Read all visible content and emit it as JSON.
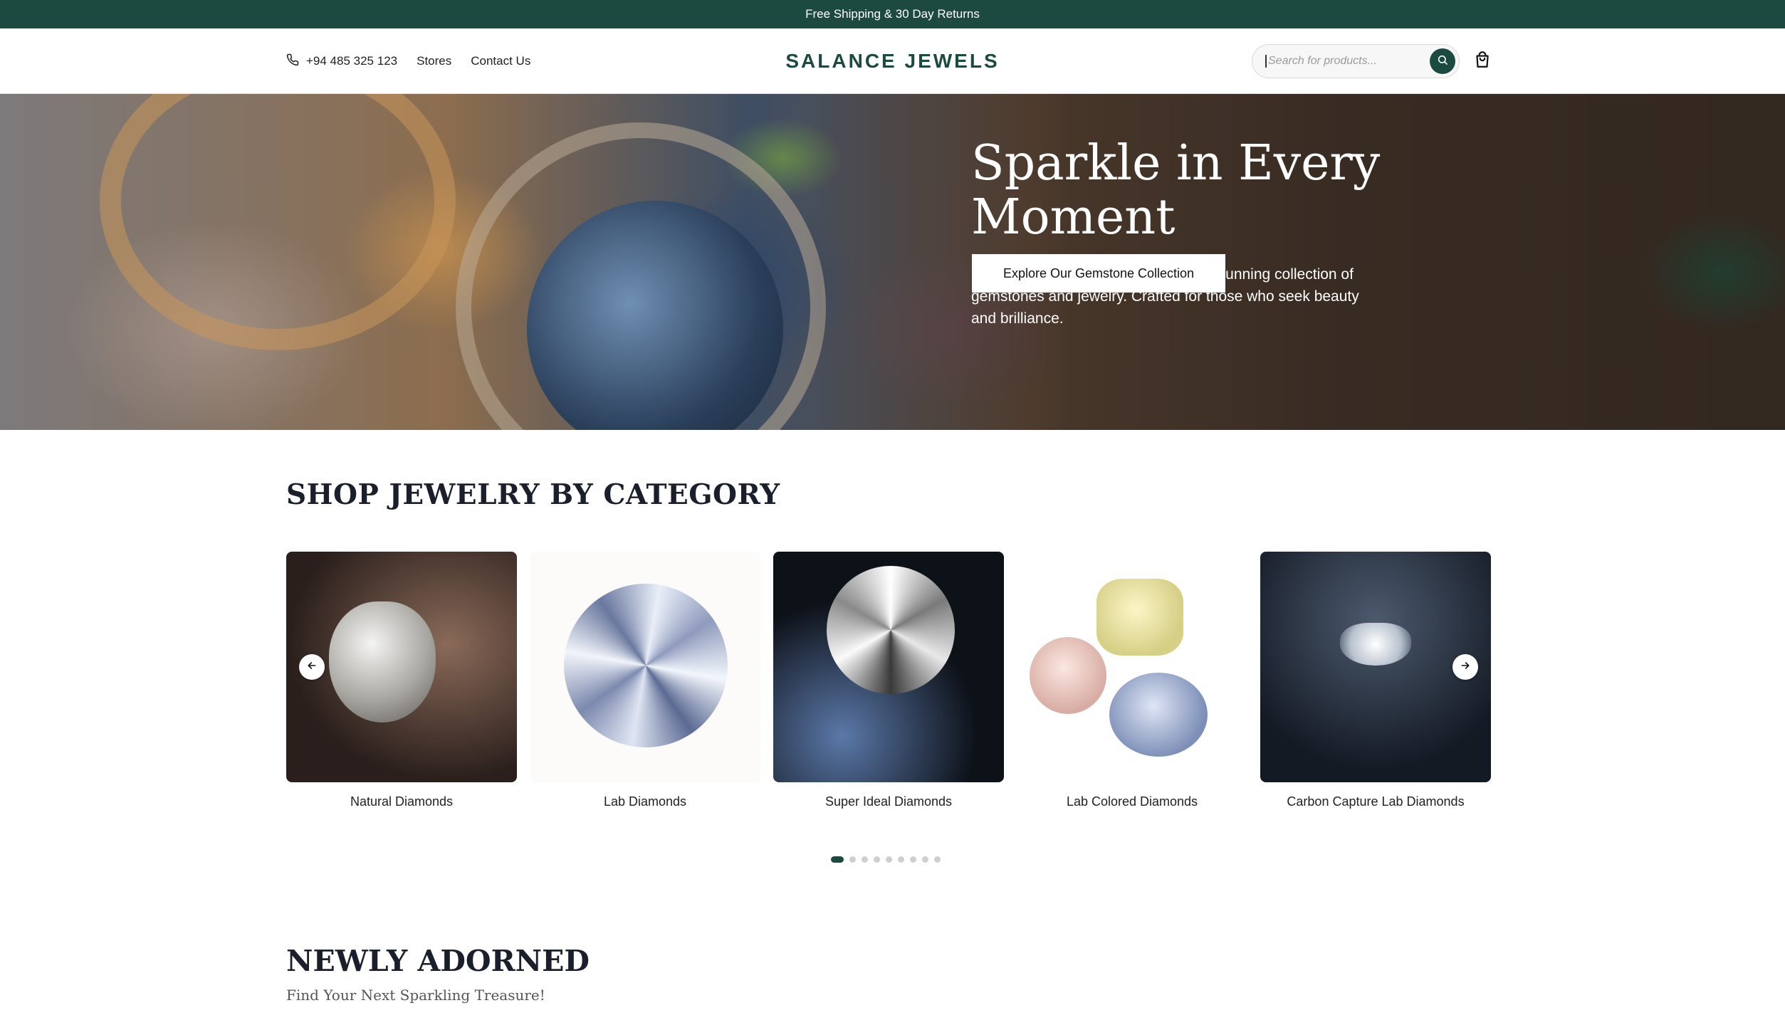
{
  "announcement": "Free Shipping & 30 Day Returns",
  "header": {
    "phone": "+94 485 325 123",
    "nav": [
      "Stores",
      "Contact Us"
    ],
    "logo": "SALANCE JEWELS",
    "search_placeholder": "Search for products...",
    "icons": [
      "phone-icon",
      "search-icon",
      "shopping-bag-icon"
    ]
  },
  "hero": {
    "title": "Sparkle in Every Moment",
    "subtitle": "Discover timeless elegance with our stunning collection of gemstones and jewelry. Crafted for those who seek beauty and brilliance.",
    "cta": "Explore Our Gemstone Collection"
  },
  "categories": {
    "title": "SHOP JEWELRY BY CATEGORY",
    "items": [
      {
        "label": "Natural Diamonds"
      },
      {
        "label": "Lab Diamonds"
      },
      {
        "label": "Super Ideal Diamonds"
      },
      {
        "label": "Lab Colored Diamonds"
      },
      {
        "label": "Carbon Capture Lab Diamonds"
      }
    ],
    "pagination": {
      "total": 9,
      "active": 1
    },
    "arrows": [
      "arrow-left-icon",
      "arrow-right-icon"
    ]
  },
  "newly_adorned": {
    "title": "NEWLY ADORNED",
    "subtitle": "Find Your Next Sparkling Treasure!"
  },
  "colors": {
    "brand": "#1c4a40",
    "text_dark": "#1a1f2b"
  }
}
